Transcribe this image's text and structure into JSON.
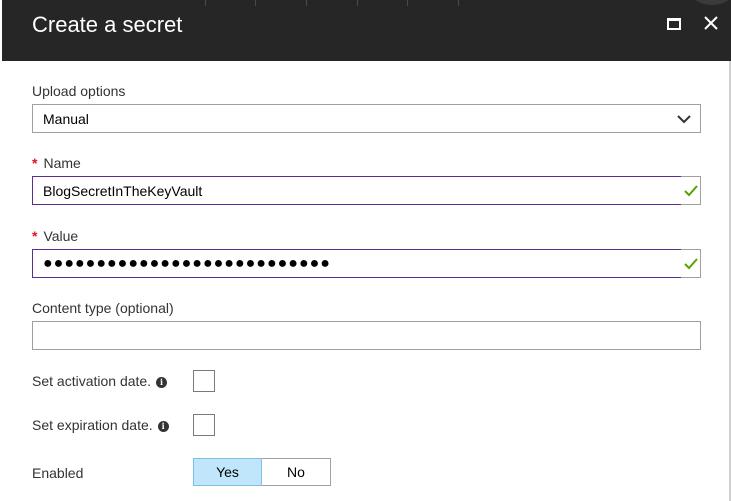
{
  "header": {
    "title": "Create a secret",
    "maximize_icon": "maximize-icon",
    "close_icon": "close-icon",
    "background_color": "#262626"
  },
  "form": {
    "upload_options": {
      "label": "Upload options",
      "selected": "Manual"
    },
    "name": {
      "required_marker": "*",
      "label": "Name",
      "value": "BlogSecretInTheKeyVault",
      "valid": true
    },
    "value": {
      "required_marker": "*",
      "label": "Value",
      "masked_value": "●●●●●●●●●●●●●●●●●●●●●●●●●●●",
      "valid": true
    },
    "content_type": {
      "label": "Content type (optional)",
      "value": ""
    },
    "activation_date": {
      "label": "Set activation date.",
      "checked": false
    },
    "expiration_date": {
      "label": "Set expiration date.",
      "checked": false
    },
    "enabled": {
      "label": "Enabled",
      "options": [
        "Yes",
        "No"
      ],
      "selected": "Yes"
    }
  },
  "colors": {
    "required": "#e81123",
    "valid_check": "#57a300",
    "valid_border": "#5c2d91",
    "selected_toggle": "#bfe6fa"
  }
}
